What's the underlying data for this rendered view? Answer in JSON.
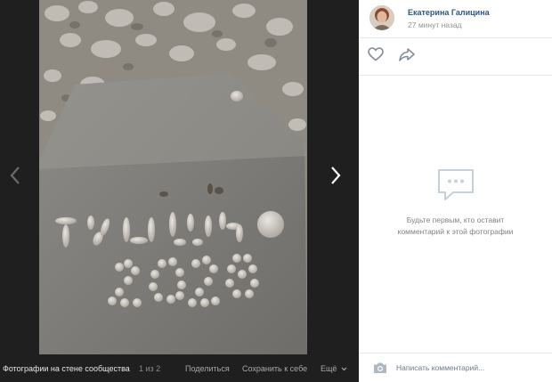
{
  "viewer": {
    "photo_description_words": "",
    "album_label": "Фотографии на стене сообщества",
    "counter": "1 из 2",
    "share_label": "Поделиться",
    "save_label": "Сохранить к себе",
    "more_label": "Ещё"
  },
  "sidebar": {
    "author_name": "Екатерина Галицина",
    "post_time": "27 минут назад",
    "empty_text": "Будьте первым, кто оставит комментарий к этой фотографии",
    "comment_placeholder": "Написать комментарий..."
  },
  "colors": {
    "viewer_bg": "#1f1f1f",
    "link": "#2a5885",
    "muted": "#939393",
    "icon": "#828a99",
    "icon_light": "#aeb7c2"
  },
  "icons": [
    "chevron-left-icon",
    "chevron-right-icon",
    "heart-icon",
    "share-icon",
    "comments-icon",
    "camera-icon",
    "chevron-down-icon"
  ]
}
